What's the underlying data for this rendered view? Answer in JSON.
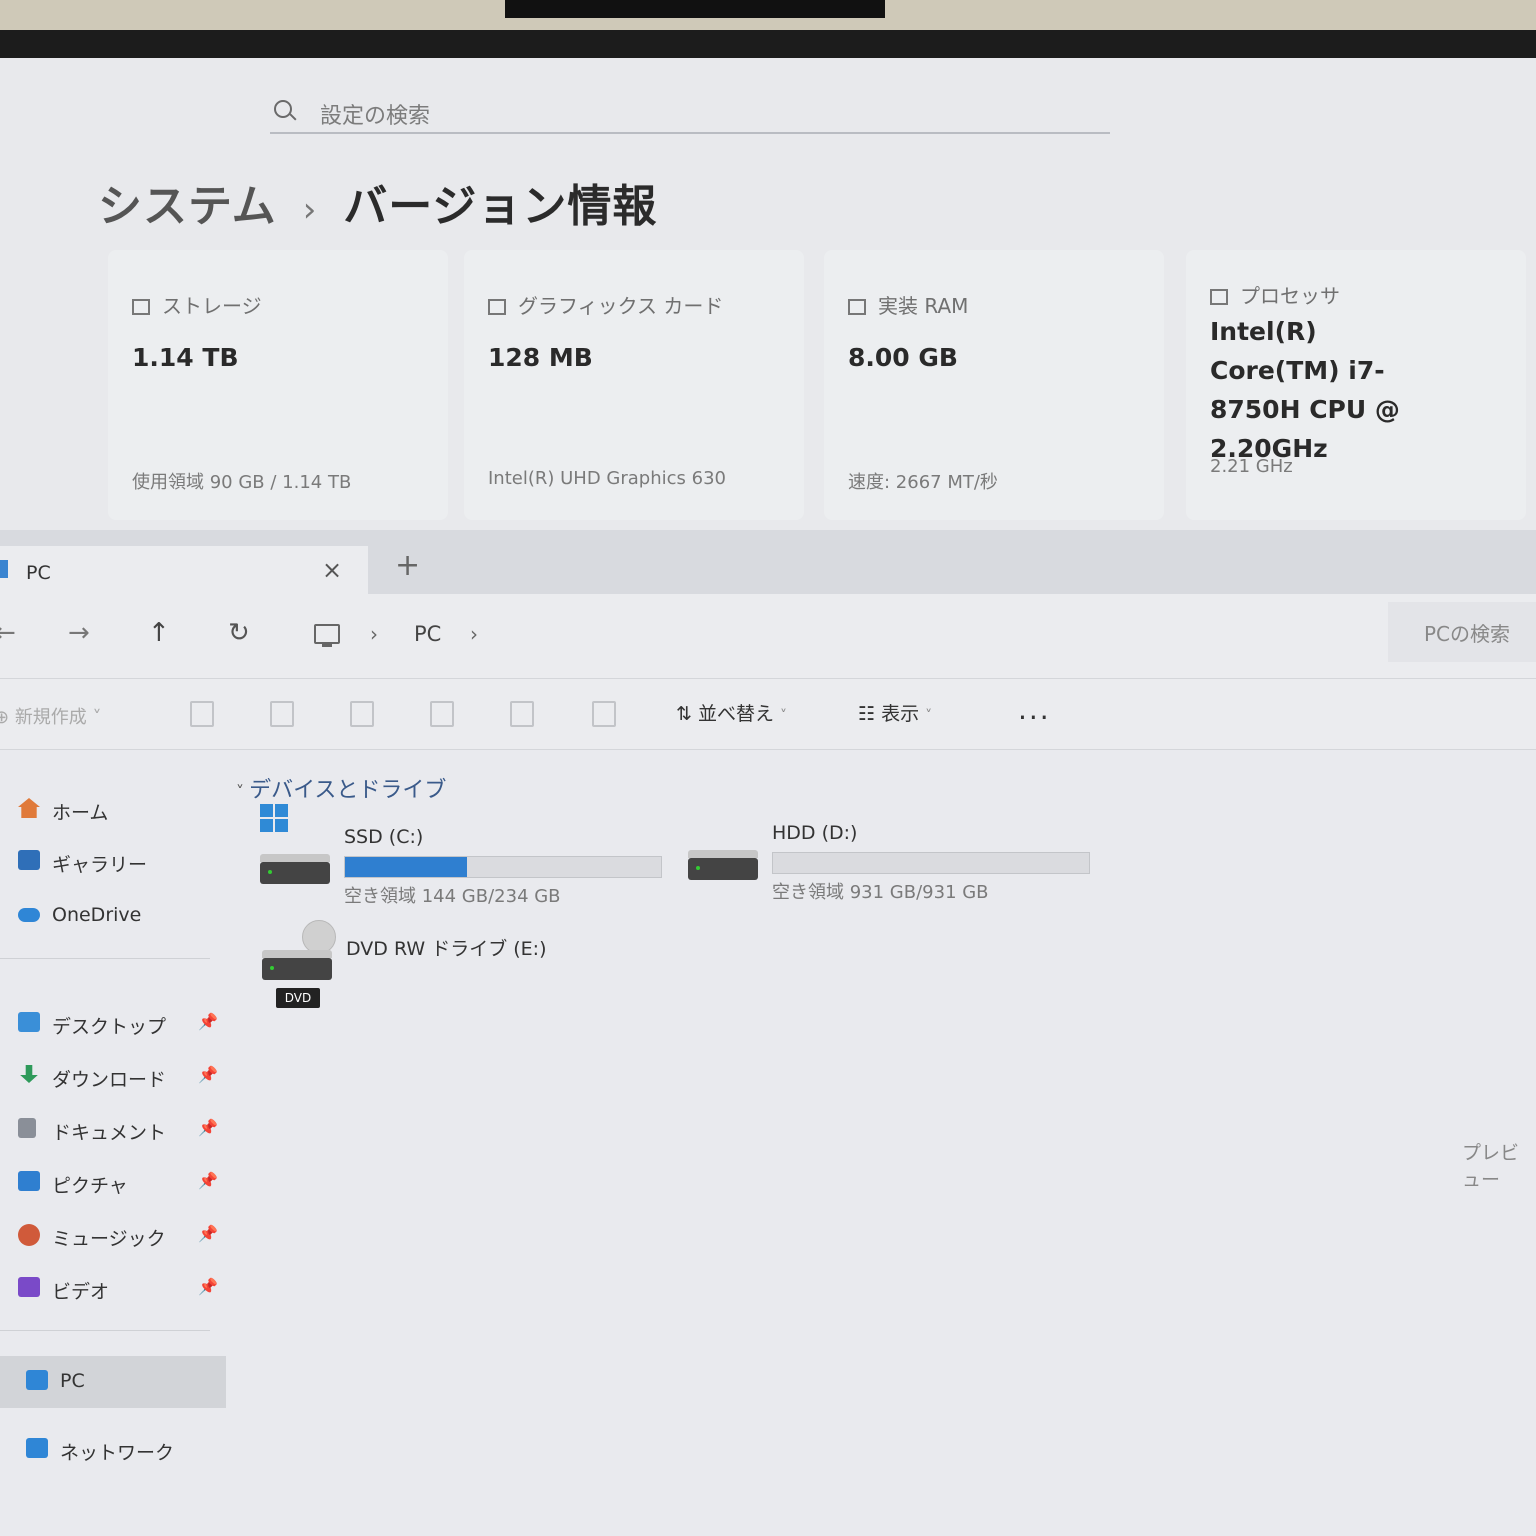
{
  "settings": {
    "search_placeholder": "設定の検索",
    "breadcrumb_parent": "システム",
    "breadcrumb_sep": "›",
    "page_title": "バージョン情報",
    "cards": [
      {
        "label": "ストレージ",
        "value": "1.14 TB",
        "sub": "使用領域 90 GB / 1.14 TB",
        "icon": "storage-icon"
      },
      {
        "label": "グラフィックス カード",
        "value": "128 MB",
        "sub": "Intel(R) UHD Graphics 630",
        "icon": "gpu-icon"
      },
      {
        "label": "実装 RAM",
        "value": "8.00 GB",
        "sub": "速度: 2667 MT/秒",
        "icon": "ram-icon"
      },
      {
        "label": "プロセッサ",
        "value": "Intel(R) Core(TM) i7-8750H CPU @ 2.20GHz",
        "sub": "2.21 GHz",
        "icon": "cpu-icon"
      }
    ]
  },
  "explorer": {
    "tab_title": "PC",
    "tab_close": "×",
    "new_tab": "+",
    "nav": {
      "back": "←",
      "forward": "→",
      "up": "↑",
      "refresh": "↻"
    },
    "address": {
      "sep": "›",
      "location": "PC"
    },
    "search_placeholder": "PCの検索",
    "toolbar": {
      "new": "新規作成",
      "sort": "並べ替え",
      "view": "表示",
      "more": "..."
    },
    "sidebar": {
      "top": [
        {
          "label": "ホーム",
          "icon": "home-icon",
          "color": "#e07a3a"
        },
        {
          "label": "ギャラリー",
          "icon": "gallery-icon",
          "color": "#2f6fb8"
        },
        {
          "label": "OneDrive",
          "icon": "onedrive-icon",
          "color": "#2f86d6"
        }
      ],
      "pinned": [
        {
          "label": "デスクトップ",
          "icon": "desktop-icon",
          "color": "#3a8fd8"
        },
        {
          "label": "ダウンロード",
          "icon": "download-icon",
          "color": "#2e9a5a"
        },
        {
          "label": "ドキュメント",
          "icon": "document-icon",
          "color": "#8a8f98"
        },
        {
          "label": "ピクチャ",
          "icon": "picture-icon",
          "color": "#2f7fd0"
        },
        {
          "label": "ミュージック",
          "icon": "music-icon",
          "color": "#d05a3a"
        },
        {
          "label": "ビデオ",
          "icon": "video-icon",
          "color": "#7a4ac8"
        }
      ],
      "pin_glyph": "📌",
      "pc": {
        "label": "PC",
        "icon": "pc-icon",
        "color": "#2f86d6"
      },
      "network": {
        "label": "ネットワーク",
        "icon": "network-icon",
        "color": "#2f86d6"
      }
    },
    "group_title": "デバイスとドライブ",
    "drives": [
      {
        "name": "SSD (C:)",
        "free": "空き領域 144 GB/234 GB",
        "used_fraction": 0.385
      },
      {
        "name": "HDD (D:)",
        "free": "空き領域 931 GB/931 GB",
        "used_fraction": 0.0
      },
      {
        "name": "DVD RW ドライブ (E:)",
        "tag": "DVD"
      }
    ],
    "preview_label": "プレビュー"
  }
}
